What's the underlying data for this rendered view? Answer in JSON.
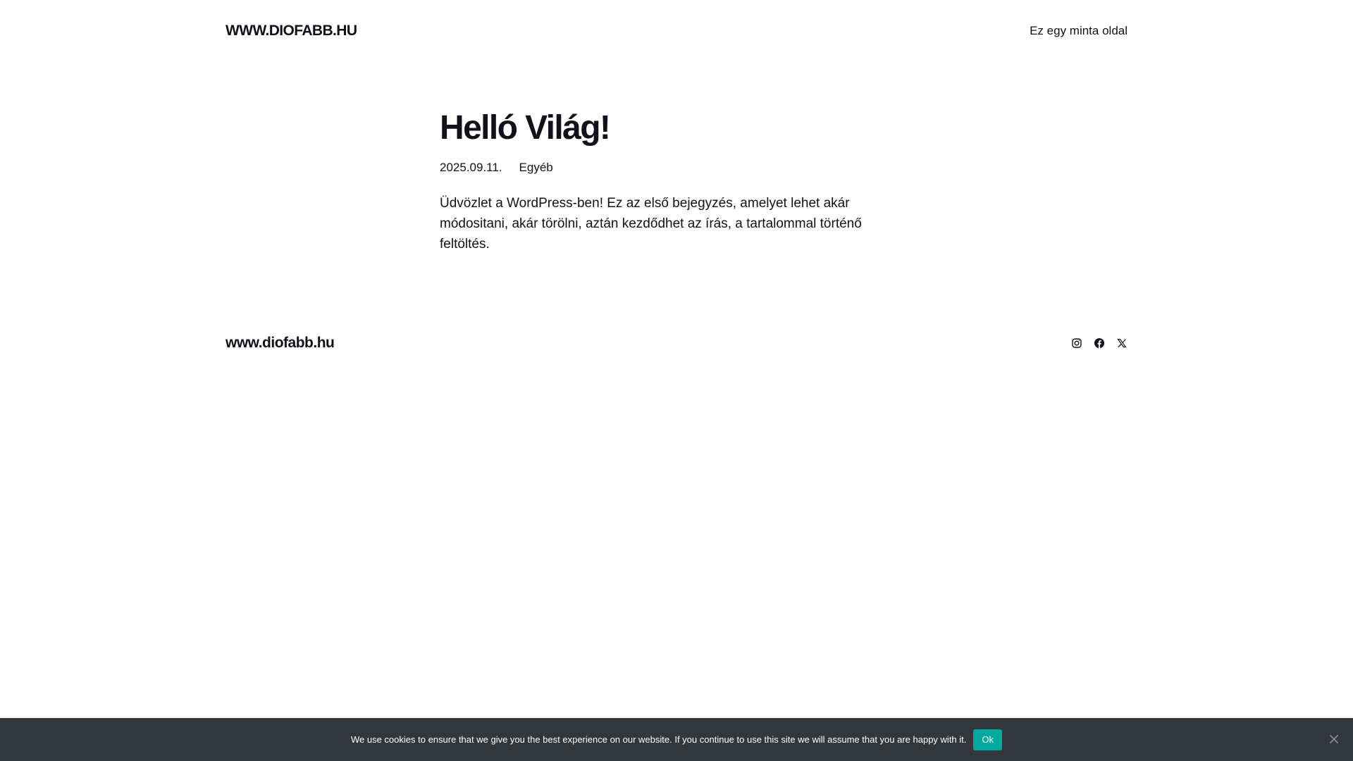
{
  "header": {
    "site_title": "WWW.DIOFABB.HU",
    "nav_link": "Ez egy minta oldal"
  },
  "post": {
    "title": "Helló Világ!",
    "date": "2025.09.11.",
    "category": "Egyéb",
    "content": "Üdvözlet a WordPress-ben! Ez az első bejegyzés, amelyet lehet akár módositani, akár törölni, aztán kezdődhet az írás, a tartalommal történő feltöltés."
  },
  "footer": {
    "site_title": "www.diofabb.hu",
    "social_icons": [
      "instagram-icon",
      "facebook-icon",
      "x-icon"
    ]
  },
  "cookie_notice": {
    "text": "We use cookies to ensure that we give you the best experience on our website. If you continue to use this site we will assume that you are happy with it.",
    "ok_label": "Ok",
    "close_icon": "close-icon",
    "background_color": "#32373c",
    "button_color": "#00a99d"
  }
}
